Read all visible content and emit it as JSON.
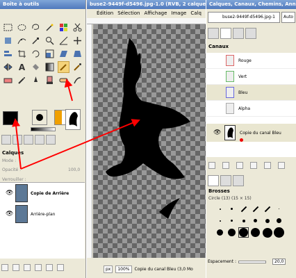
{
  "toolbox": {
    "title": "Boîte à outils",
    "layers_title": "Calques",
    "mode_label": "Mode :",
    "opacity_label": "Opacité :",
    "opacity_value": "100,0",
    "lock_label": "Verrouiller :",
    "layers": [
      {
        "name": "Copie de Arrière"
      },
      {
        "name": "Arrière-plan"
      }
    ]
  },
  "canvas": {
    "title": "buse2-9449f-d5496.jpg-1.0 (RVB, 2 calques)",
    "menu": [
      "Édition",
      "Sélection",
      "Affichage",
      "Image",
      "Calq"
    ],
    "unit": "px",
    "zoom": "100%",
    "status": "Copie du canal Bleu (3,0 Mo"
  },
  "dock": {
    "title": "Calques, Canaux, Chemins, Ann...",
    "image_select": "buse2-9449f-d5496.jpg-1",
    "auto_label": "Auto",
    "channels_title": "Canaux",
    "channels": [
      {
        "name": "Rouge"
      },
      {
        "name": "Vert"
      },
      {
        "name": "Bleu"
      },
      {
        "name": "Alpha"
      }
    ],
    "copy_channel": "Copie du canal Bleu",
    "brushes_title": "Brosses",
    "brush_name": "Circle (13) (15 × 15)",
    "spacing_label": "Espacement :",
    "spacing_value": "20,0"
  },
  "colors": {
    "annotation": "#ff0000",
    "foreground": "#000000",
    "background": "#ffffff"
  }
}
